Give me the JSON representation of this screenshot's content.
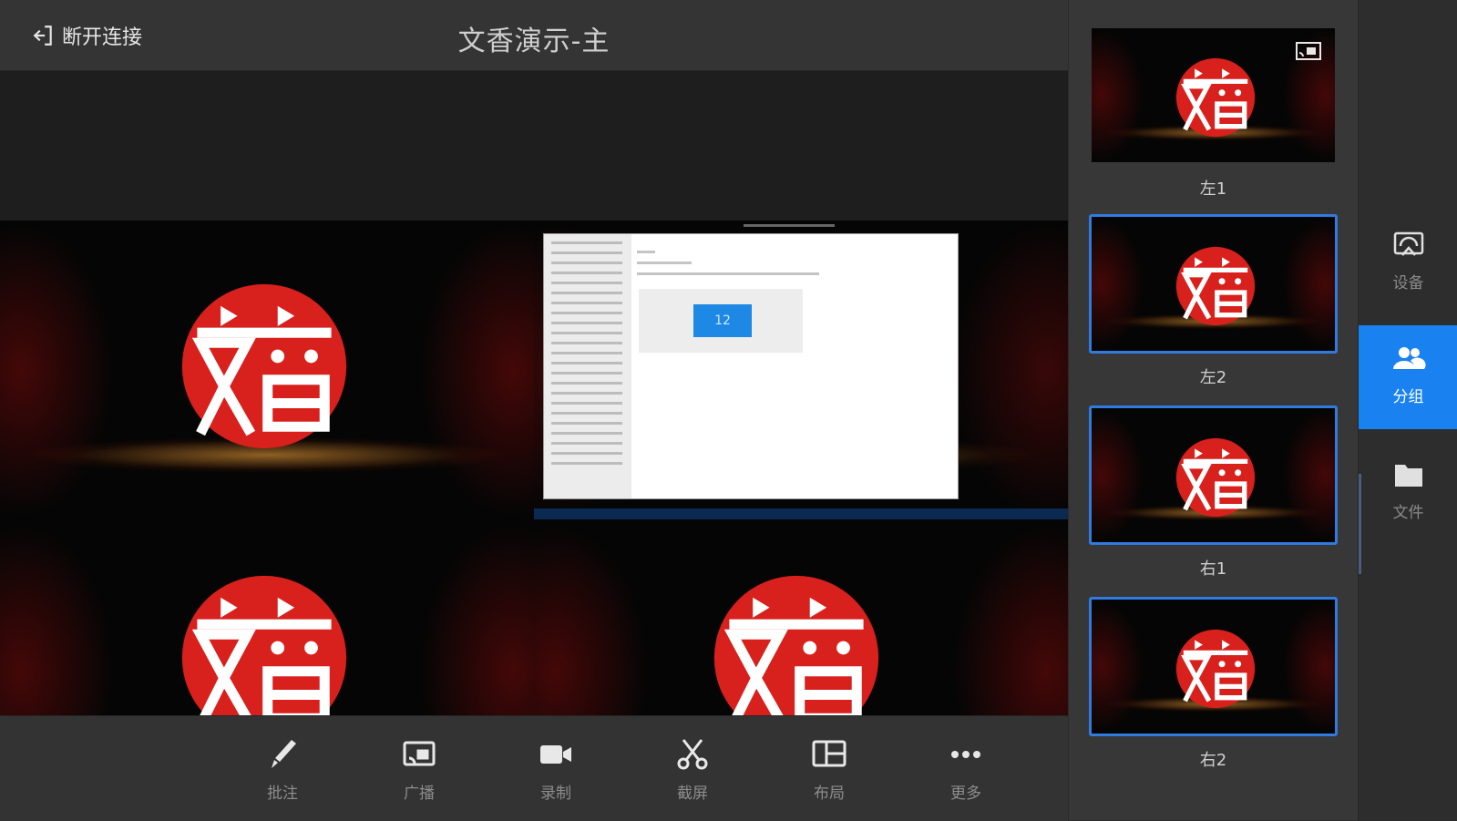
{
  "header": {
    "disconnect_label": "断开连接",
    "title": "文香演示-主"
  },
  "stage": {
    "tiles": [
      {
        "content": "logo"
      },
      {
        "content": "desktop",
        "monitor_number": "12"
      },
      {
        "content": "logo"
      },
      {
        "content": "logo"
      }
    ]
  },
  "toolbar": {
    "items": [
      {
        "label": "批注",
        "icon": "pen-icon"
      },
      {
        "label": "广播",
        "icon": "broadcast-icon"
      },
      {
        "label": "录制",
        "icon": "camera-icon"
      },
      {
        "label": "截屏",
        "icon": "scissors-icon"
      },
      {
        "label": "布局",
        "icon": "layout-icon"
      },
      {
        "label": "更多",
        "icon": "more-icon"
      }
    ]
  },
  "previews": {
    "items": [
      {
        "name": "左1",
        "selected": false,
        "badge": "cast-icon"
      },
      {
        "name": "左2",
        "selected": true
      },
      {
        "name": "右1",
        "selected": true
      },
      {
        "name": "右2",
        "selected": true
      }
    ]
  },
  "nav": {
    "items": [
      {
        "label": "设备",
        "icon": "device-icon",
        "active": false
      },
      {
        "label": "分组",
        "icon": "group-icon",
        "active": true
      },
      {
        "label": "文件",
        "icon": "folder-icon",
        "active": false
      }
    ]
  },
  "colors": {
    "accent": "#1a82f0",
    "selection_border": "#2f7be0",
    "logo_red": "#d8201c"
  }
}
